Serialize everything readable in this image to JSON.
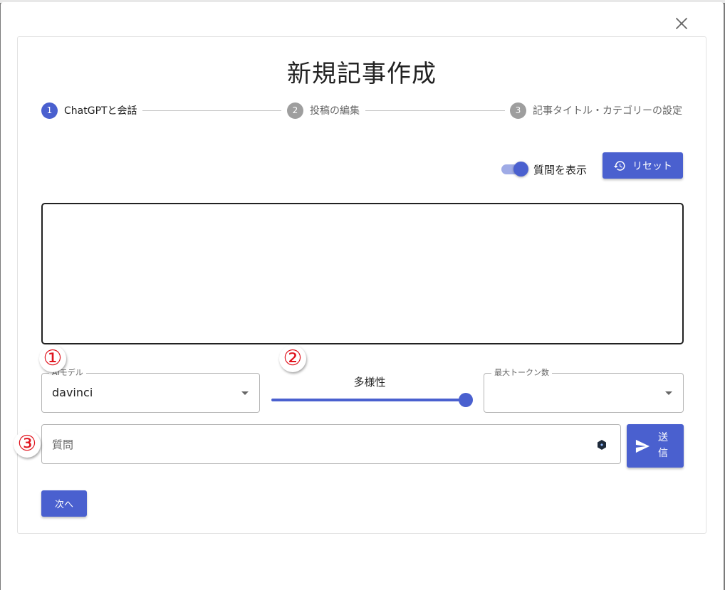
{
  "dialog": {
    "title": "新規記事作成",
    "close_icon": "close-icon"
  },
  "stepper": {
    "steps": [
      {
        "number": "1",
        "label": "ChatGPTと会話",
        "active": true
      },
      {
        "number": "2",
        "label": "投稿の編集",
        "active": false
      },
      {
        "number": "3",
        "label": "記事タイトル・カテゴリーの設定",
        "active": false
      }
    ]
  },
  "toolbar": {
    "toggle_label": "質問を表示",
    "toggle_on": true,
    "reset_label": "リセット",
    "reset_icon": "restore-icon"
  },
  "model_select": {
    "label": "AIモデル",
    "value": "davinci"
  },
  "diversity_slider": {
    "label": "多様性",
    "value_fraction": 1.0
  },
  "max_tokens_select": {
    "label": "最大トークン数",
    "value": ""
  },
  "question": {
    "placeholder": "質問",
    "icon": "extension-icon"
  },
  "send_button": {
    "label": "送信",
    "icon": "send-icon"
  },
  "next_button": {
    "label": "次へ"
  },
  "annotations": {
    "marker1": "①",
    "marker2": "②",
    "marker3": "③"
  },
  "colors": {
    "primary": "#4a60cf",
    "annotation": "#e0141e"
  }
}
